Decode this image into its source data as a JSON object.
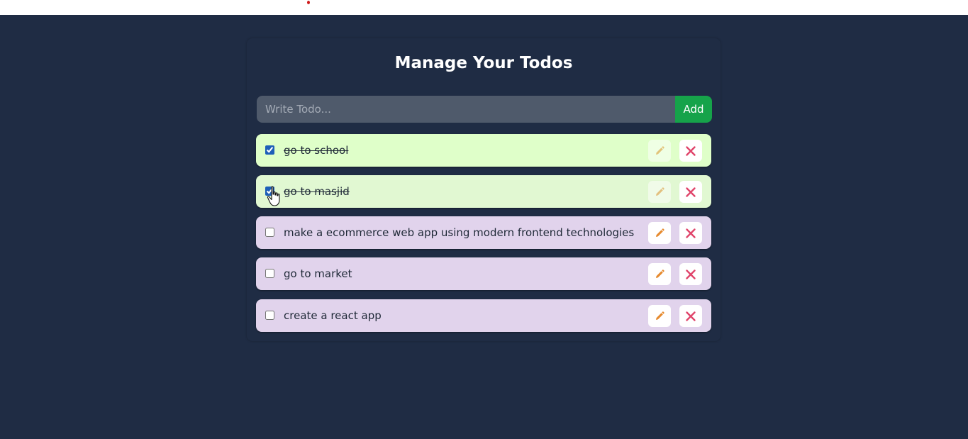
{
  "app": {
    "title": "Manage Your Todos"
  },
  "input": {
    "placeholder": "Write Todo...",
    "value": "",
    "add_label": "Add"
  },
  "todos": [
    {
      "text": "go to school",
      "completed": true,
      "bg": "#dfffc9"
    },
    {
      "text": "go to masjid",
      "completed": true,
      "bg": "#e1f8d2"
    },
    {
      "text": "make a ecommerce web app using modern frontend technologies",
      "completed": false,
      "bg": "#e1d3ec"
    },
    {
      "text": "go to market",
      "completed": false,
      "bg": "#e1d3ec"
    },
    {
      "text": "create a react app",
      "completed": false,
      "bg": "#e1d3ec"
    }
  ],
  "icons": {
    "edit": "pencil-icon",
    "delete": "close-icon"
  },
  "colors": {
    "background": "#1f2c44",
    "input_bg": "#4f5a6b",
    "add_button": "#16a34a",
    "edit_icon": "#e68a2e",
    "delete_icon": "#e0446a",
    "checkbox": "#1e5fb8"
  }
}
